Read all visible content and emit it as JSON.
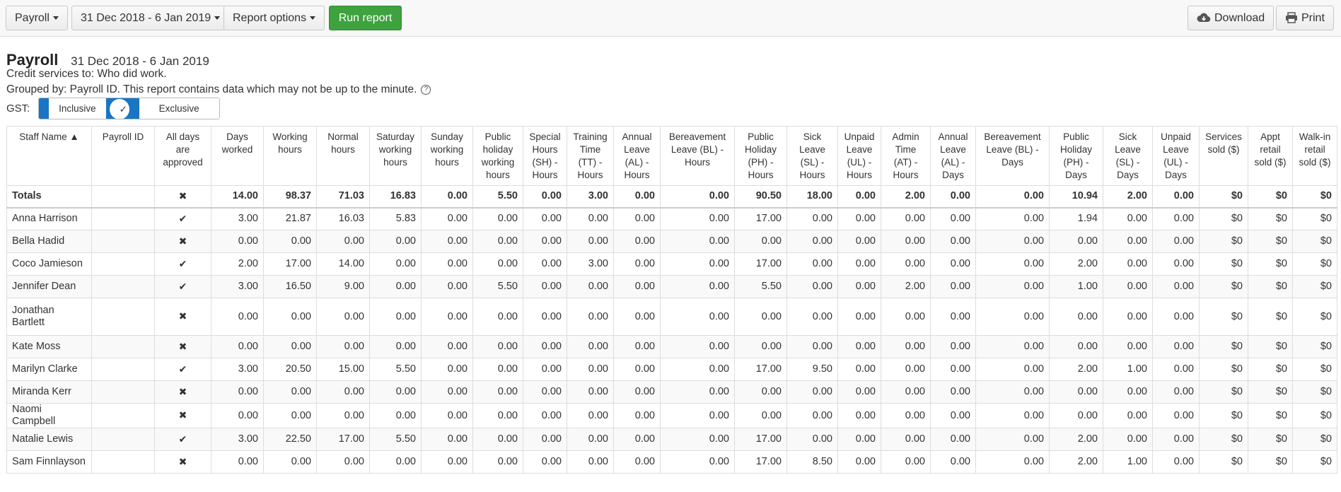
{
  "toolbar": {
    "report_type": "Payroll",
    "date_range": "31 Dec 2018 - 6 Jan 2019",
    "report_options": "Report options",
    "run_report": "Run report",
    "download": "Download",
    "print": "Print"
  },
  "report": {
    "title": "Payroll",
    "dates": "31 Dec 2018 - 6 Jan 2019",
    "credit_line": "Credit services to: Who did work.",
    "grouped_line": "Grouped by: Payroll ID. This report contains data which may not be up to the minute.",
    "help_icon": "question-circle-icon",
    "gst_label": "GST:",
    "gst_inclusive": "Inclusive",
    "gst_exclusive": "Exclusive"
  },
  "colors": {
    "run_button": "#3ea23e",
    "active_toggle": "#1a75c4"
  },
  "table": {
    "headers": [
      "Staff Name ▲",
      "Payroll ID",
      "All days are approved",
      "Days worked",
      "Working hours",
      "Normal hours",
      "Saturday working hours",
      "Sunday working hours",
      "Public holiday working hours",
      "Special Hours (SH) - Hours",
      "Training Time (TT) - Hours",
      "Annual Leave (AL) - Hours",
      "Bereavement Leave (BL) - Hours",
      "Public Holiday (PH) - Hours",
      "Sick Leave (SL) - Hours",
      "Unpaid Leave (UL) - Hours",
      "Admin Time (AT) - Hours",
      "Annual Leave (AL) - Days",
      "Bereavement Leave (BL) - Days",
      "Public Holiday (PH) - Days",
      "Sick Leave (SL) - Days",
      "Unpaid Leave (UL) - Days",
      "Services sold ($)",
      "Appt retail sold ($)",
      "Walk-in retail sold ($)"
    ],
    "totals": {
      "name": "Totals",
      "payroll_id": "",
      "approved": "cross",
      "values": [
        "14.00",
        "98.37",
        "71.03",
        "16.83",
        "0.00",
        "5.50",
        "0.00",
        "3.00",
        "0.00",
        "0.00",
        "90.50",
        "18.00",
        "0.00",
        "2.00",
        "0.00",
        "0.00",
        "10.94",
        "2.00",
        "0.00",
        "$0",
        "$0",
        "$0"
      ]
    },
    "rows": [
      {
        "name": "Anna Harrison",
        "payroll_id": "",
        "approved": "check",
        "values": [
          "3.00",
          "21.87",
          "16.03",
          "5.83",
          "0.00",
          "0.00",
          "0.00",
          "0.00",
          "0.00",
          "0.00",
          "17.00",
          "0.00",
          "0.00",
          "0.00",
          "0.00",
          "0.00",
          "1.94",
          "0.00",
          "0.00",
          "$0",
          "$0",
          "$0"
        ]
      },
      {
        "name": "Bella Hadid",
        "payroll_id": "",
        "approved": "cross",
        "values": [
          "0.00",
          "0.00",
          "0.00",
          "0.00",
          "0.00",
          "0.00",
          "0.00",
          "0.00",
          "0.00",
          "0.00",
          "0.00",
          "0.00",
          "0.00",
          "0.00",
          "0.00",
          "0.00",
          "0.00",
          "0.00",
          "0.00",
          "$0",
          "$0",
          "$0"
        ]
      },
      {
        "name": "Coco Jamieson",
        "payroll_id": "",
        "approved": "check",
        "values": [
          "2.00",
          "17.00",
          "14.00",
          "0.00",
          "0.00",
          "0.00",
          "0.00",
          "3.00",
          "0.00",
          "0.00",
          "17.00",
          "0.00",
          "0.00",
          "0.00",
          "0.00",
          "0.00",
          "2.00",
          "0.00",
          "0.00",
          "$0",
          "$0",
          "$0"
        ]
      },
      {
        "name": "Jennifer Dean",
        "payroll_id": "",
        "approved": "check",
        "values": [
          "3.00",
          "16.50",
          "9.00",
          "0.00",
          "0.00",
          "5.50",
          "0.00",
          "0.00",
          "0.00",
          "0.00",
          "5.50",
          "0.00",
          "0.00",
          "2.00",
          "0.00",
          "0.00",
          "1.00",
          "0.00",
          "0.00",
          "$0",
          "$0",
          "$0"
        ]
      },
      {
        "name": "Jonathan Bartlett",
        "payroll_id": "",
        "approved": "cross",
        "values": [
          "0.00",
          "0.00",
          "0.00",
          "0.00",
          "0.00",
          "0.00",
          "0.00",
          "0.00",
          "0.00",
          "0.00",
          "0.00",
          "0.00",
          "0.00",
          "0.00",
          "0.00",
          "0.00",
          "0.00",
          "0.00",
          "0.00",
          "$0",
          "$0",
          "$0"
        ]
      },
      {
        "name": "Kate Moss",
        "payroll_id": "",
        "approved": "cross",
        "values": [
          "0.00",
          "0.00",
          "0.00",
          "0.00",
          "0.00",
          "0.00",
          "0.00",
          "0.00",
          "0.00",
          "0.00",
          "0.00",
          "0.00",
          "0.00",
          "0.00",
          "0.00",
          "0.00",
          "0.00",
          "0.00",
          "0.00",
          "$0",
          "$0",
          "$0"
        ]
      },
      {
        "name": "Marilyn Clarke",
        "payroll_id": "",
        "approved": "check",
        "values": [
          "3.00",
          "20.50",
          "15.00",
          "5.50",
          "0.00",
          "0.00",
          "0.00",
          "0.00",
          "0.00",
          "0.00",
          "17.00",
          "9.50",
          "0.00",
          "0.00",
          "0.00",
          "0.00",
          "2.00",
          "1.00",
          "0.00",
          "$0",
          "$0",
          "$0"
        ]
      },
      {
        "name": "Miranda Kerr",
        "payroll_id": "",
        "approved": "cross",
        "values": [
          "0.00",
          "0.00",
          "0.00",
          "0.00",
          "0.00",
          "0.00",
          "0.00",
          "0.00",
          "0.00",
          "0.00",
          "0.00",
          "0.00",
          "0.00",
          "0.00",
          "0.00",
          "0.00",
          "0.00",
          "0.00",
          "0.00",
          "$0",
          "$0",
          "$0"
        ]
      },
      {
        "name": "Naomi Campbell",
        "payroll_id": "",
        "approved": "cross",
        "values": [
          "0.00",
          "0.00",
          "0.00",
          "0.00",
          "0.00",
          "0.00",
          "0.00",
          "0.00",
          "0.00",
          "0.00",
          "0.00",
          "0.00",
          "0.00",
          "0.00",
          "0.00",
          "0.00",
          "0.00",
          "0.00",
          "0.00",
          "$0",
          "$0",
          "$0"
        ]
      },
      {
        "name": "Natalie Lewis",
        "payroll_id": "",
        "approved": "check",
        "values": [
          "3.00",
          "22.50",
          "17.00",
          "5.50",
          "0.00",
          "0.00",
          "0.00",
          "0.00",
          "0.00",
          "0.00",
          "17.00",
          "0.00",
          "0.00",
          "0.00",
          "0.00",
          "0.00",
          "2.00",
          "0.00",
          "0.00",
          "$0",
          "$0",
          "$0"
        ]
      },
      {
        "name": "Sam Finnlayson",
        "payroll_id": "",
        "approved": "cross",
        "values": [
          "0.00",
          "0.00",
          "0.00",
          "0.00",
          "0.00",
          "0.00",
          "0.00",
          "0.00",
          "0.00",
          "0.00",
          "17.00",
          "8.50",
          "0.00",
          "0.00",
          "0.00",
          "0.00",
          "2.00",
          "1.00",
          "0.00",
          "$0",
          "$0",
          "$0"
        ]
      }
    ]
  }
}
